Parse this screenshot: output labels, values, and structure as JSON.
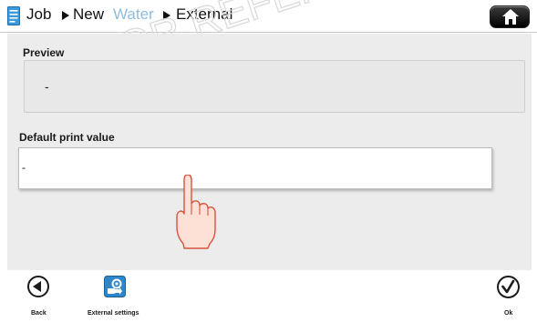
{
  "breadcrumb": {
    "items": [
      "Job",
      "New",
      "Water",
      "External"
    ]
  },
  "watermark": {
    "text": "FOR REFERENCE ONLY"
  },
  "preview": {
    "label": "Preview",
    "value": "-"
  },
  "default_print_value": {
    "label": "Default print value",
    "value": "-"
  },
  "footer": {
    "back_label": "Back",
    "external_settings_label": "External settings",
    "ok_label": "Ok"
  },
  "colors": {
    "accent_blue": "#2f86c8",
    "panel_gray": "#ececec",
    "hand_skin": "#fde0d6",
    "hand_outline": "#d9533f"
  },
  "icons": {
    "title_icon": "document-icon",
    "home": "home-icon",
    "back": "back-arrow-icon",
    "external_settings": "external-settings-icon",
    "ok": "checkmark-icon",
    "pointer": "touch-hand-icon"
  }
}
